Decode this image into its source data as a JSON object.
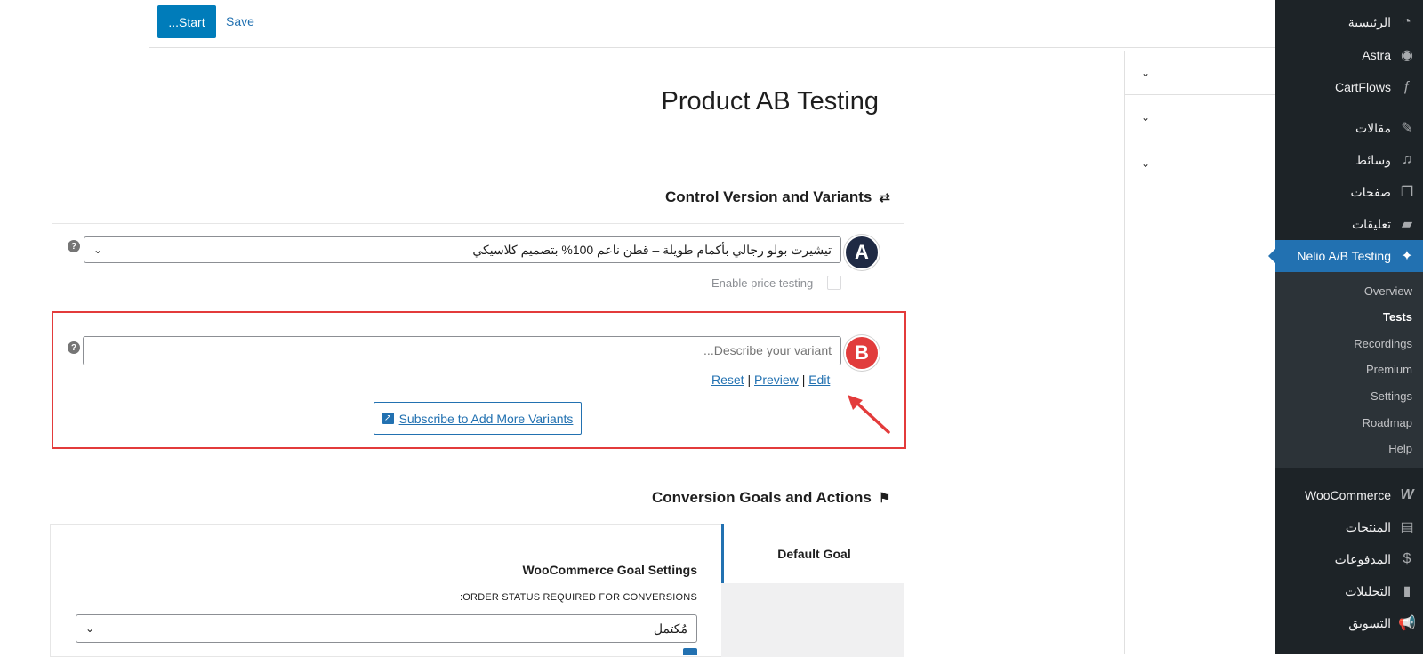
{
  "toolbar": {
    "start_label": "...Start",
    "save_label": "Save"
  },
  "editor": {
    "page_title": "Product AB Testing",
    "control_section_title": "Control Version and Variants",
    "control_section_icon": "shuffle-icon",
    "control_product": {
      "selected_value": "تيشيرت بولو رجالي بأكمام طويلة – قطن ناعم 100% بتصميم كلاسيكي",
      "badge": "A"
    },
    "price_testing_label": "Enable price testing",
    "variant": {
      "placeholder": "...Describe your variant",
      "badge": "B",
      "reset_label": "Reset",
      "preview_label": "Preview",
      "edit_label": "Edit",
      "separator": "|"
    },
    "subscribe_label": "Subscribe to Add More Variants",
    "conversion_section_title": "Conversion Goals and Actions",
    "conversion_section_icon": "flag-icon",
    "default_goal_tab": "Default Goal",
    "woo_goal_title": "WooCommerce Goal Settings",
    "order_status_label": ":ORDER STATUS REQUIRED FOR CONVERSIONS",
    "order_status_value": "مُكتمل"
  },
  "sidebar": {
    "items": [
      {
        "label": "الرئيسية",
        "icon": "dashboard-icon"
      },
      {
        "label": "Astra",
        "icon": "astra-icon"
      },
      {
        "label": "CartFlows",
        "icon": "cartflows-icon"
      },
      {
        "label": "مقالات",
        "icon": "pin-icon"
      },
      {
        "label": "وسائط",
        "icon": "media-icon"
      },
      {
        "label": "صفحات",
        "icon": "pages-icon"
      },
      {
        "label": "تعليقات",
        "icon": "comments-icon"
      },
      {
        "label": "Nelio A/B Testing",
        "icon": "nelio-icon"
      },
      {
        "label": "WooCommerce",
        "icon": "woocommerce-icon"
      },
      {
        "label": "المنتجات",
        "icon": "products-icon"
      },
      {
        "label": "المدفوعات",
        "icon": "payments-icon"
      },
      {
        "label": "التحليلات",
        "icon": "analytics-icon"
      },
      {
        "label": "التسويق",
        "icon": "marketing-icon"
      }
    ],
    "submenu": [
      "Overview",
      "Tests",
      "Recordings",
      "Premium",
      "Settings",
      "Roadmap",
      "Help"
    ],
    "accent_color": "#2271b1"
  }
}
